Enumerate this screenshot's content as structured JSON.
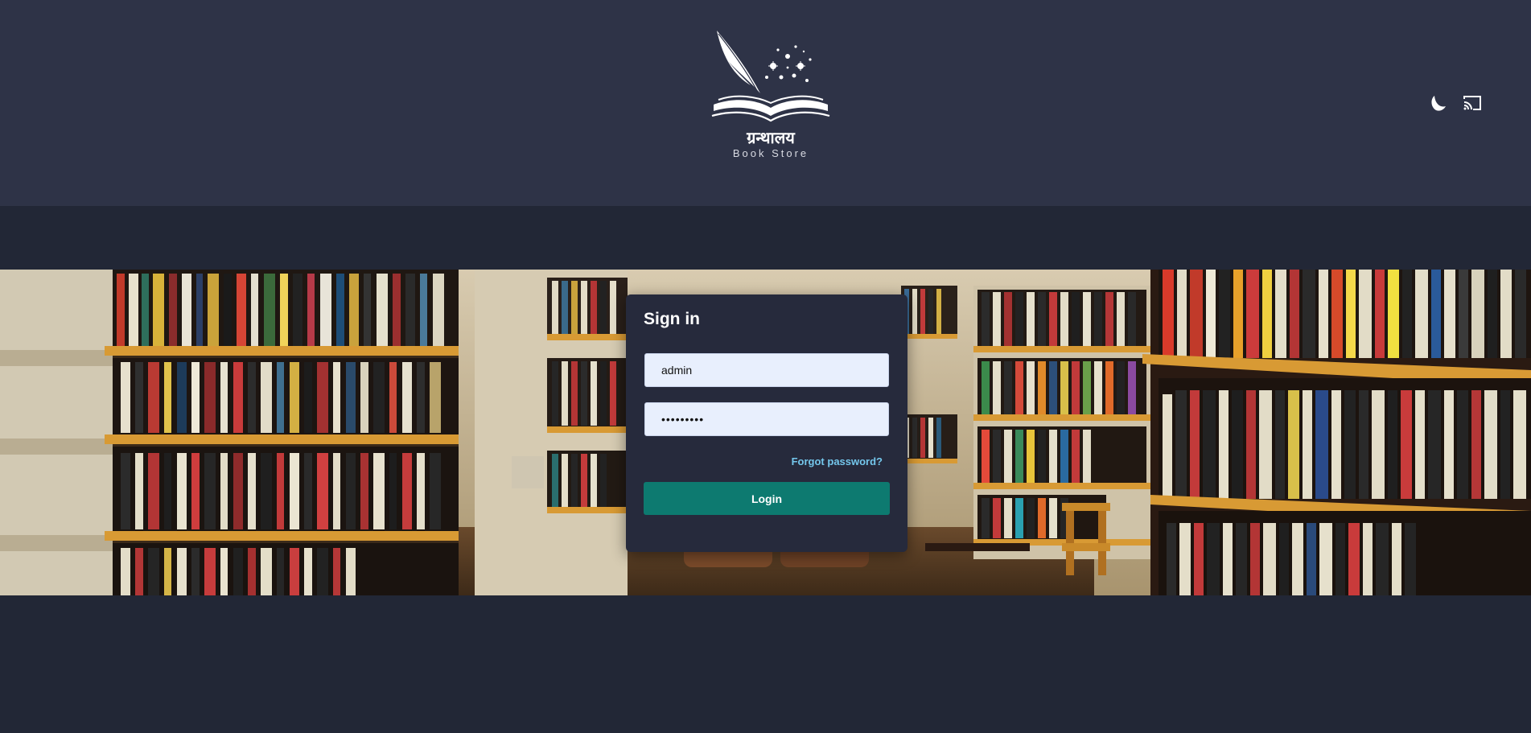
{
  "header": {
    "logo_text": "ग्रन्थालय",
    "logo_subtitle": "Book Store",
    "theme_toggle_icon": "moon-icon",
    "cast_icon": "cast-icon"
  },
  "hero": {
    "background": "library-bookshelves-photo"
  },
  "login": {
    "title": "Sign in",
    "username_value": "admin",
    "password_value": "•••••••••",
    "forgot_label": "Forgot password?",
    "login_label": "Login"
  },
  "colors": {
    "header_bg": "#2e3347",
    "page_bg": "#222736",
    "card_bg": "#262a3c",
    "primary_button": "#0d7a70",
    "link": "#74c7ec",
    "input_bg": "#e8effd"
  }
}
